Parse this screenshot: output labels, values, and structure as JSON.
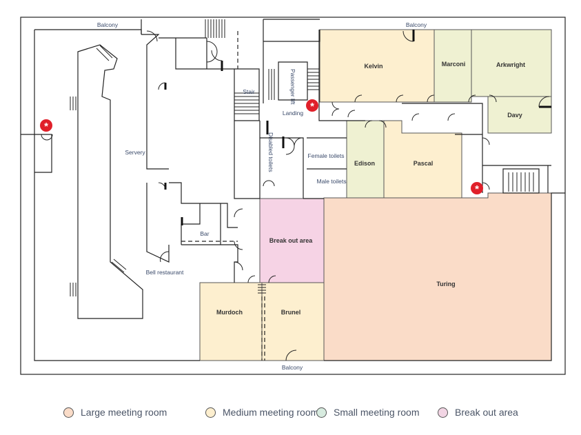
{
  "colors": {
    "large": "#fadcc8",
    "medium": "#fdefcf",
    "small": "#eff1d2",
    "small_legend": "#d7ebdf",
    "breakout": "#f6d3e5",
    "fire_marker": "#e0202a"
  },
  "labels": {
    "balcony_top_left": "Balcony",
    "balcony_top_right": "Balcony",
    "balcony_bottom": "Balcony",
    "servery": "Servery",
    "bell_restaurant": "Bell restaurant",
    "bar": "Bar",
    "stair": "Stair",
    "passenger_lift": "Passenger lift",
    "landing": "Landing",
    "disabled_toilets": "Disabled toilets",
    "female_toilets": "Female toilets",
    "male_toilets": "Male toilets"
  },
  "rooms": {
    "kelvin": {
      "name": "Kelvin",
      "size": "medium"
    },
    "marconi": {
      "name": "Marconi",
      "size": "small"
    },
    "arkwright": {
      "name": "Arkwright",
      "size": "small"
    },
    "davy": {
      "name": "Davy",
      "size": "small"
    },
    "edison": {
      "name": "Edison",
      "size": "small"
    },
    "pascal": {
      "name": "Pascal",
      "size": "medium"
    },
    "breakout": {
      "name": "Break out area",
      "size": "breakout"
    },
    "turing": {
      "name": "Turing",
      "size": "large"
    },
    "murdoch": {
      "name": "Murdoch",
      "size": "medium"
    },
    "brunel": {
      "name": "Brunel",
      "size": "medium"
    }
  },
  "legend": [
    {
      "label": "Large meeting room",
      "color": "#fadcc8"
    },
    {
      "label": "Medium meeting room",
      "color": "#fdefcf"
    },
    {
      "label": "Small meeting room",
      "color": "#d7ebdf"
    },
    {
      "label": "Break out area",
      "color": "#f2d5e4"
    }
  ],
  "icons": {
    "fire_marker": "fire-assembly-marker-icon"
  }
}
